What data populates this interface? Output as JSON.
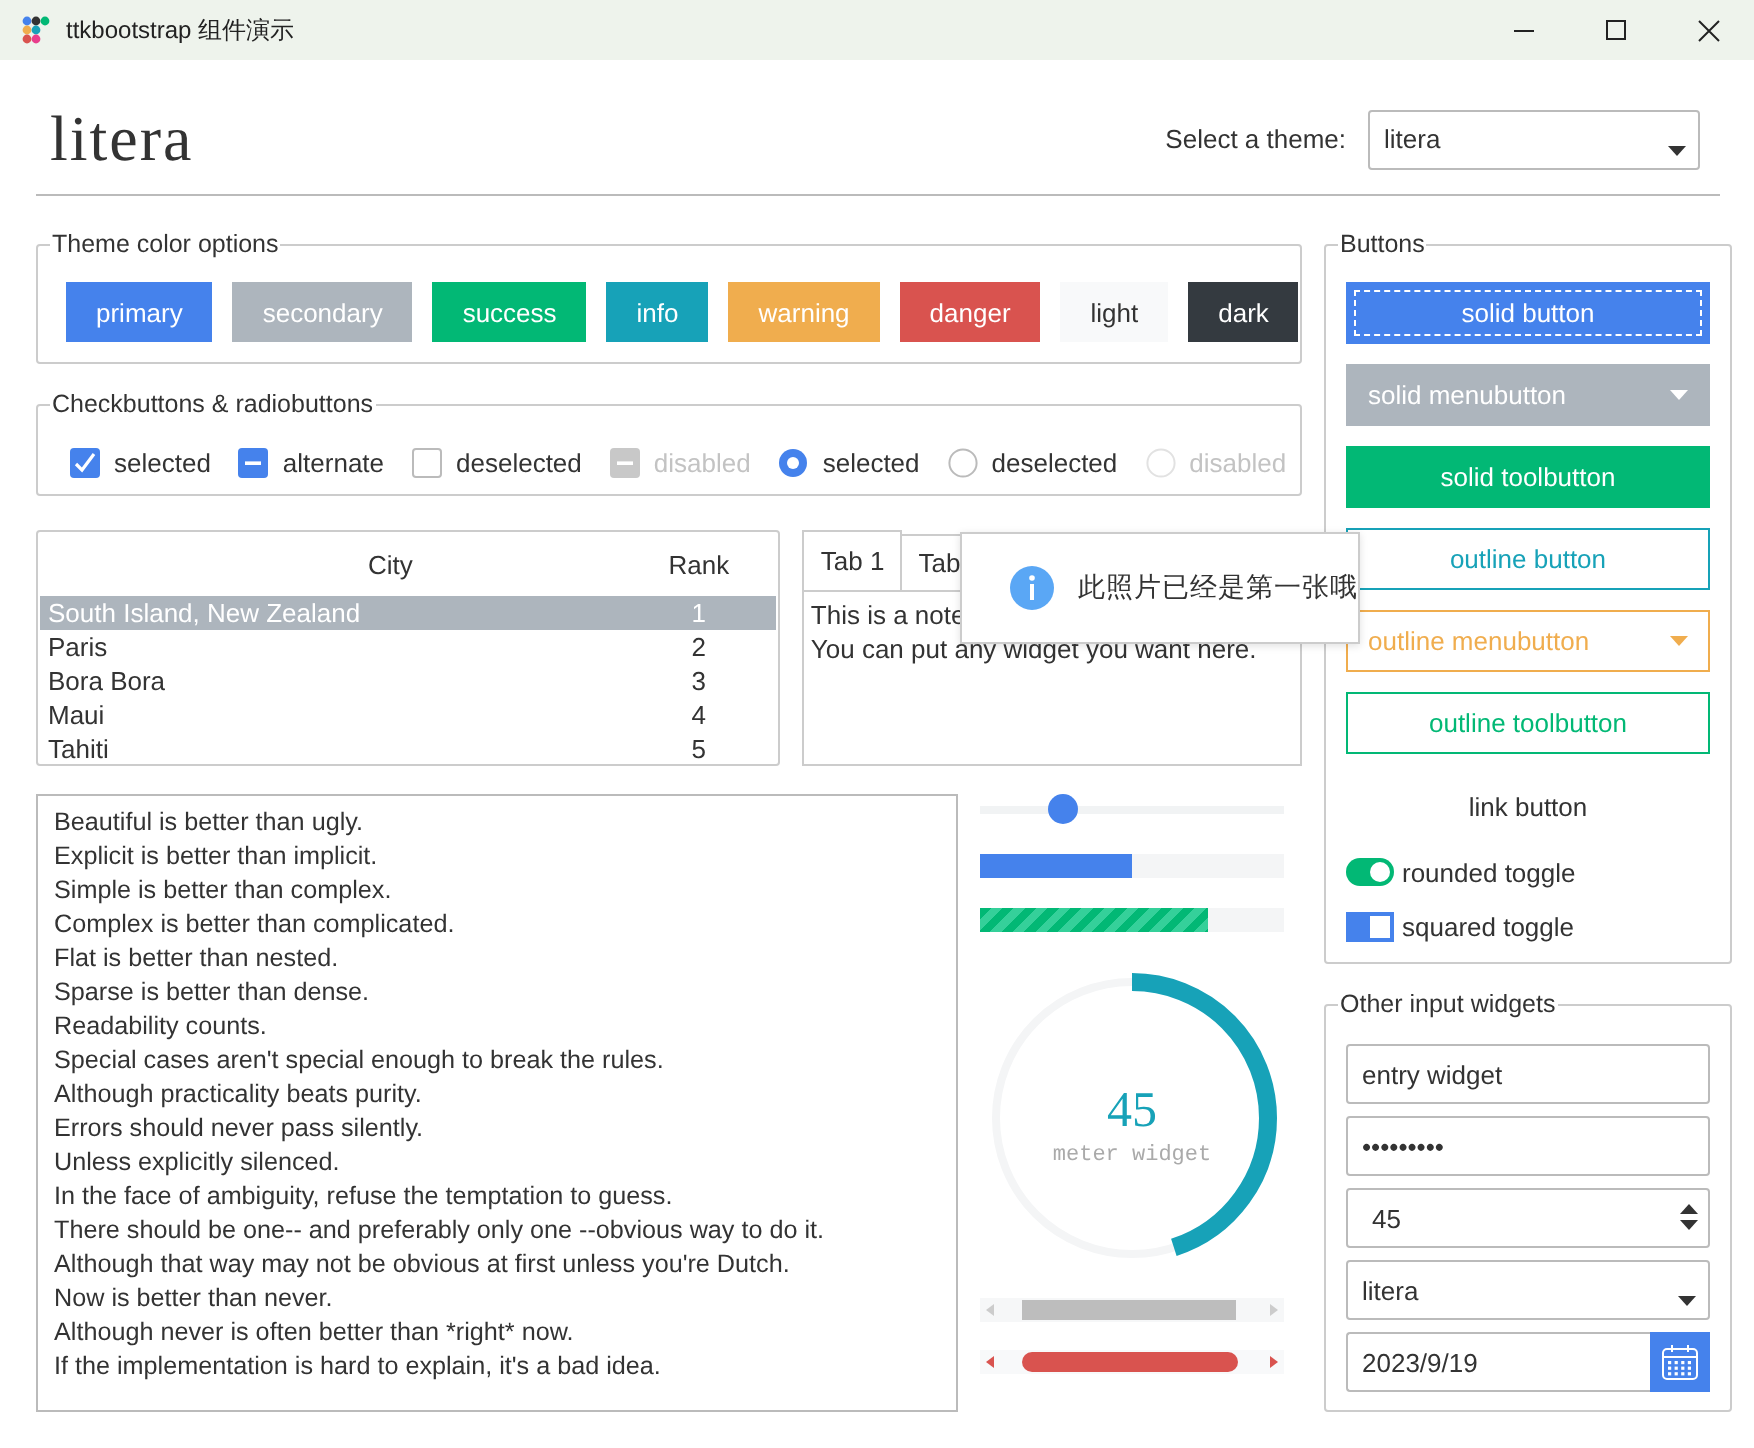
{
  "window": {
    "title": "ttkbootstrap 组件演示"
  },
  "header": {
    "theme_name": "litera",
    "theme_label": "Select a theme:",
    "theme_value": "litera"
  },
  "theme_colors": {
    "title": "Theme color options",
    "buttons": [
      {
        "label": "primary",
        "color": "#4582ec"
      },
      {
        "label": "secondary",
        "color": "#adb5bd"
      },
      {
        "label": "success",
        "color": "#02b875"
      },
      {
        "label": "info",
        "color": "#17a2b8"
      },
      {
        "label": "warning",
        "color": "#f0ad4e"
      },
      {
        "label": "danger",
        "color": "#d9534f"
      },
      {
        "label": "light",
        "color": "#f8f9fa"
      },
      {
        "label": "dark",
        "color": "#343a40"
      }
    ]
  },
  "checks": {
    "title": "Checkbuttons & radiobuttons",
    "items": [
      {
        "kind": "checkbox",
        "label": "selected",
        "checked": true,
        "alternate": false,
        "disabled": false
      },
      {
        "kind": "checkbox",
        "label": "alternate",
        "checked": false,
        "alternate": true,
        "disabled": false
      },
      {
        "kind": "checkbox",
        "label": "deselected",
        "checked": false,
        "alternate": false,
        "disabled": false
      },
      {
        "kind": "checkbox",
        "label": "disabled",
        "checked": false,
        "alternate": true,
        "disabled": true
      },
      {
        "kind": "radio",
        "label": "selected",
        "checked": true,
        "disabled": false
      },
      {
        "kind": "radio",
        "label": "deselected",
        "checked": false,
        "disabled": false
      },
      {
        "kind": "radio",
        "label": "disabled",
        "checked": false,
        "disabled": true
      }
    ]
  },
  "table": {
    "columns": [
      "City",
      "Rank"
    ],
    "rows": [
      {
        "city": "South Island, New Zealand",
        "rank": "1",
        "selected": true
      },
      {
        "city": "Paris",
        "rank": "2",
        "selected": false
      },
      {
        "city": "Bora Bora",
        "rank": "3",
        "selected": false
      },
      {
        "city": "Maui",
        "rank": "4",
        "selected": false
      },
      {
        "city": "Tahiti",
        "rank": "5",
        "selected": false
      }
    ]
  },
  "notebook": {
    "tabs": [
      {
        "label": "Tab 1",
        "selected": true
      },
      {
        "label": "Tab",
        "selected": false
      }
    ],
    "note_lines": [
      "This is a note",
      "You can put any widget you want here."
    ]
  },
  "toast": {
    "message": "此照片已经是第一张哦"
  },
  "text_area": {
    "lines": [
      "Beautiful is better than ugly.",
      "Explicit is better than implicit.",
      "Simple is better than complex.",
      "Complex is better than complicated.",
      "Flat is better than nested.",
      "Sparse is better than dense.",
      "Readability counts.",
      "Special cases aren't special enough to break the rules.",
      "Although practicality beats purity.",
      "Errors should never pass silently.",
      "Unless explicitly silenced.",
      "In the face of ambiguity, refuse the temptation to guess.",
      "There should be one-- and preferably only one --obvious way to do it.",
      "Although that way may not be obvious at first unless you're Dutch.",
      "Now is better than never.",
      "Although never is often better than *right* now.",
      "If the implementation is hard to explain, it's a bad idea."
    ]
  },
  "scale": {
    "level": 0.27
  },
  "progress": {
    "level": 0.5
  },
  "striped_progress": {
    "level": 0.75
  },
  "meter": {
    "level": 0.45,
    "value": "45",
    "label": "meter widget"
  },
  "buttons": {
    "title": "Buttons",
    "items": [
      {
        "kind": "solid",
        "label": "solid button",
        "color": "#4582ec",
        "focused": true
      },
      {
        "kind": "solid-menu",
        "label": "solid menubutton",
        "color": "#adb5bd"
      },
      {
        "kind": "solid",
        "label": "solid toolbutton",
        "color": "#02b875"
      },
      {
        "kind": "outline",
        "label": "outline button",
        "color": "#17a2b8"
      },
      {
        "kind": "outline-menu",
        "label": "outline menubutton",
        "color": "#f0ad4e"
      },
      {
        "kind": "outline",
        "label": "outline toolbutton",
        "color": "#02b875"
      },
      {
        "kind": "link",
        "label": "link button",
        "color": "#333333"
      },
      {
        "kind": "round-toggle",
        "label": "rounded toggle",
        "color": "#02b875",
        "on": true
      },
      {
        "kind": "square-toggle",
        "label": "squared toggle",
        "color": "#4582ec",
        "on": true
      }
    ]
  },
  "inputs": {
    "title": "Other input widgets",
    "entry": "entry widget",
    "password": "•••••••••",
    "spinbox": "45",
    "combobox": "litera",
    "date": "2023/9/19"
  }
}
